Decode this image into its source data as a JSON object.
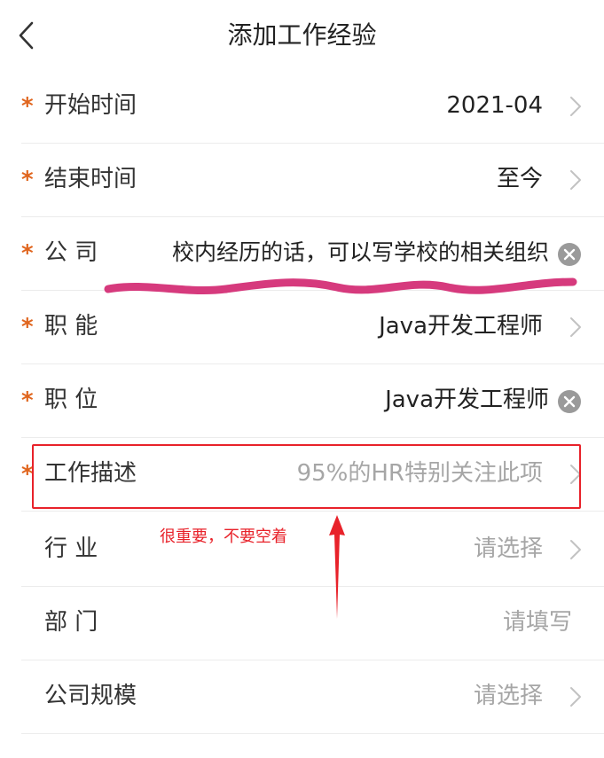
{
  "header": {
    "title": "添加工作经验"
  },
  "required_mark": "*",
  "form": {
    "start_time": {
      "label": "开始时间",
      "value": "2021-04"
    },
    "end_time": {
      "label": "结束时间",
      "value": "至今"
    },
    "company": {
      "label": "公 司",
      "value": "校内经历的话，可以写学校的相关组织"
    },
    "function": {
      "label": "职 能",
      "value": "Java开发工程师"
    },
    "position": {
      "label": "职 位",
      "value": "Java开发工程师"
    },
    "job_description": {
      "label": "工作描述",
      "placeholder": "95%的HR特别关注此项"
    },
    "industry": {
      "label": "行 业",
      "placeholder": "请选择"
    },
    "department": {
      "label": "部 门",
      "placeholder": "请填写"
    },
    "company_size": {
      "label": "公司规模",
      "placeholder": "请选择"
    }
  },
  "annotation": {
    "note": "很重要，不要空着",
    "color": "#e8222a",
    "underline_color": "#d63a7d"
  },
  "colors": {
    "required": "#e0651e",
    "placeholder": "#a6a6a6",
    "divider": "#ececec"
  },
  "icons": {
    "back": "chevron-left-icon",
    "row_arrow": "chevron-right-icon",
    "clear": "clear-circle-icon"
  }
}
